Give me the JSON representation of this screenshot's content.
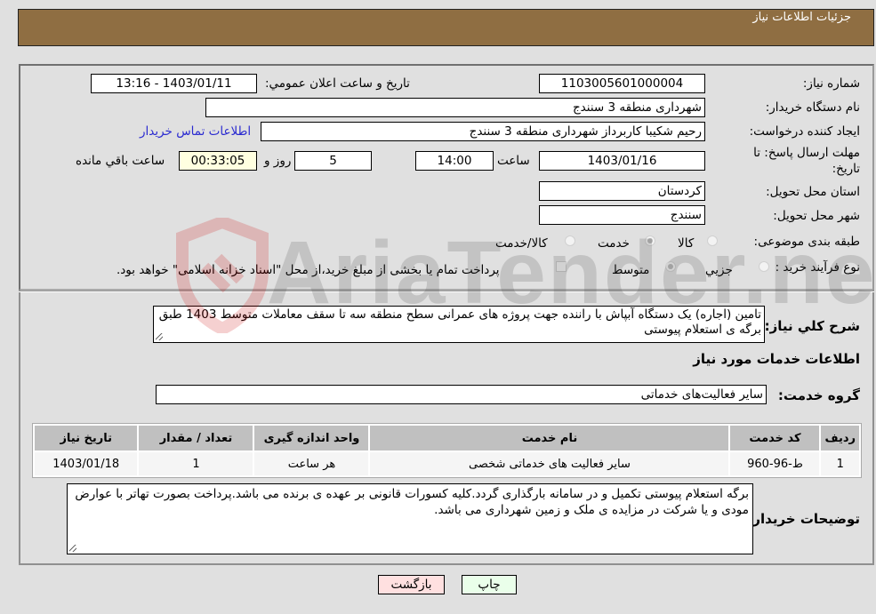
{
  "header": {
    "title": "جزئیات اطلاعات نیاز"
  },
  "form": {
    "need_number": {
      "label": "شماره نیاز:",
      "value": "1103005601000004"
    },
    "announce_datetime": {
      "label": "تاريخ و ساعت اعلان عمومي:",
      "value": "1403/01/11 - 13:16"
    },
    "buyer_org": {
      "label": "نام دستگاه خریدار:",
      "value": "شهرداری منطقه 3 سنندج"
    },
    "requester": {
      "label": "ایجاد کننده درخواست:",
      "value": "رحیم شکیبا کاربرداز شهرداری منطقه 3 سنندج"
    },
    "buyer_contact_link": "اطلاعات تماس خریدار",
    "deadline": {
      "label_line1": "مهلت ارسال پاسخ: تا",
      "label_line2": "تاریخ:",
      "date": "1403/01/16",
      "time_label": "ساعت",
      "time": "14:00",
      "days": "5",
      "days_label": "روز و",
      "remaining": "00:33:05",
      "remaining_label": "ساعت باقي مانده"
    },
    "province": {
      "label": "استان محل تحویل:",
      "value": "کردستان"
    },
    "city": {
      "label": "شهر محل تحویل:",
      "value": "سنندج"
    },
    "category": {
      "label": "طبقه بندی موضوعی:",
      "options": [
        "کالا",
        "خدمت",
        "کالا/خدمت"
      ],
      "selected": "خدمت"
    },
    "purchase_type": {
      "label": "نوع فرآیند خرید :",
      "options": [
        "جزيي",
        "متوسط"
      ],
      "selected": "متوسط",
      "treasury_note": "پرداخت تمام یا بخشی از مبلغ خرید،از محل \"اسناد خزانه اسلامی\" خواهد بود."
    }
  },
  "description": {
    "label": "شرح کلي نياز:",
    "value": "تامین (اجاره) یک دستگاه آبپاش با راننده جهت پروژه های عمرانی سطح منطقه سه تا سقف معاملات متوسط 1403 طبق برگه ی استعلام پیوستی"
  },
  "services": {
    "section_title": "اطلاعات خدمات مورد نیاز",
    "group_label": "گروه خدمت:",
    "group_value": "سایر فعالیت‌های خدماتی",
    "columns": [
      "ردیف",
      "کد خدمت",
      "نام خدمت",
      "واحد اندازه گیری",
      "تعداد / مقدار",
      "تاریخ نیاز"
    ],
    "rows": [
      [
        "1",
        "ط-96-960",
        "سایر فعالیت های خدماتی شخصی",
        "هر ساعت",
        "1",
        "1403/01/18"
      ]
    ]
  },
  "buyer_notes": {
    "label": "توضیحات خریدار:",
    "value": "برگه استعلام پیوستی تکمیل و در سامانه بارگذاری گردد.کلیه کسورات قانونی بر عهده ی برنده می باشد.پرداخت بصورت تهاتر با عوارض مودی و یا شرکت در مزایده ی ملک و زمین شهرداری می باشد."
  },
  "buttons": {
    "print": "چاپ",
    "back": "بازگشت"
  },
  "watermark": "AriaTender.neT"
}
